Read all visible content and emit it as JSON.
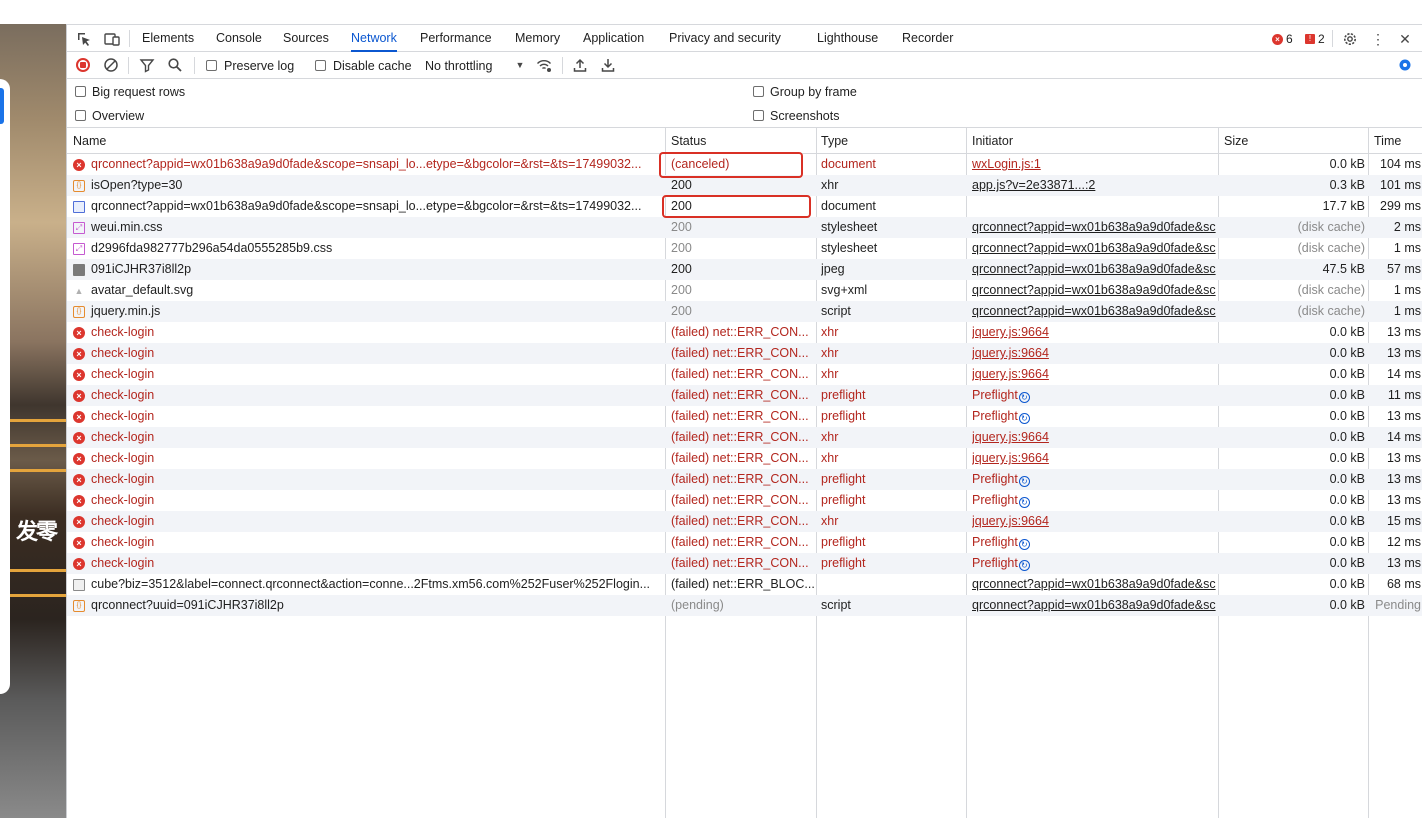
{
  "page": {
    "cjk_text": "发零"
  },
  "tabs": [
    {
      "label": "Elements"
    },
    {
      "label": "Console"
    },
    {
      "label": "Sources"
    },
    {
      "label": "Network",
      "active": true
    },
    {
      "label": "Performance"
    },
    {
      "label": "Memory"
    },
    {
      "label": "Application"
    },
    {
      "label": "Privacy and security"
    },
    {
      "label": "Lighthouse"
    },
    {
      "label": "Recorder"
    }
  ],
  "counts": {
    "errors": "6",
    "issues": "2"
  },
  "toolbar": {
    "preserve_log": "Preserve log",
    "disable_cache": "Disable cache",
    "throttling": "No throttling"
  },
  "settings": {
    "big_rows": "Big request rows",
    "overview": "Overview",
    "group_by_frame": "Group by frame",
    "screenshots": "Screenshots"
  },
  "columns": {
    "name": "Name",
    "status": "Status",
    "type": "Type",
    "initiator": "Initiator",
    "size": "Size",
    "time": "Time"
  },
  "colors": {
    "accent": "#0b57d0",
    "error": "#b3261e",
    "highlight": "#d93025"
  },
  "rows": [
    {
      "icon": "error",
      "name": "qrconnect?appid=wx01b638a9a9d0fade&scope=snsapi_lo...etype=&bgcolor=&rst=&ts=17499032...",
      "status": "(canceled)",
      "type": "document",
      "initiator": "wxLogin.js:1",
      "size": "0.0 kB",
      "time": "104 ms",
      "error": true
    },
    {
      "icon": "xhr",
      "name": "isOpen?type=30",
      "status": "200",
      "type": "xhr",
      "initiator": "app.js?v=2e33871...:2",
      "size": "0.3 kB",
      "time": "101 ms"
    },
    {
      "icon": "doc",
      "name": "qrconnect?appid=wx01b638a9a9d0fade&scope=snsapi_lo...etype=&bgcolor=&rst=&ts=17499032...",
      "status": "200",
      "type": "document",
      "initiator": "",
      "size": "17.7 kB",
      "time": "299 ms"
    },
    {
      "icon": "css",
      "name": "weui.min.css",
      "status": "200",
      "type": "stylesheet",
      "initiator": "qrconnect?appid=wx01b638a9a9d0fade&sc",
      "size": "(disk cache)",
      "time": "2 ms",
      "dim": true
    },
    {
      "icon": "css",
      "name": "d2996fda982777b296a54da0555285b9.css",
      "status": "200",
      "type": "stylesheet",
      "initiator": "qrconnect?appid=wx01b638a9a9d0fade&sc",
      "size": "(disk cache)",
      "time": "1 ms",
      "dim": true
    },
    {
      "icon": "img",
      "name": "091iCJHR37i8ll2p",
      "status": "200",
      "type": "jpeg",
      "initiator": "qrconnect?appid=wx01b638a9a9d0fade&sc",
      "size": "47.5 kB",
      "time": "57 ms"
    },
    {
      "icon": "svg",
      "name": "avatar_default.svg",
      "status": "200",
      "type": "svg+xml",
      "initiator": "qrconnect?appid=wx01b638a9a9d0fade&sc",
      "size": "(disk cache)",
      "time": "1 ms",
      "dim": true
    },
    {
      "icon": "js",
      "name": "jquery.min.js",
      "status": "200",
      "type": "script",
      "initiator": "qrconnect?appid=wx01b638a9a9d0fade&sc",
      "size": "(disk cache)",
      "time": "1 ms",
      "dim": true
    },
    {
      "icon": "error",
      "name": "check-login",
      "status": "(failed) net::ERR_CON...",
      "type": "xhr",
      "initiator": "jquery.js:9664",
      "size": "0.0 kB",
      "time": "13 ms",
      "error": true
    },
    {
      "icon": "error",
      "name": "check-login",
      "status": "(failed) net::ERR_CON...",
      "type": "xhr",
      "initiator": "jquery.js:9664",
      "size": "0.0 kB",
      "time": "13 ms",
      "error": true
    },
    {
      "icon": "error",
      "name": "check-login",
      "status": "(failed) net::ERR_CON...",
      "type": "xhr",
      "initiator": "jquery.js:9664",
      "size": "0.0 kB",
      "time": "14 ms",
      "error": true
    },
    {
      "icon": "error",
      "name": "check-login",
      "status": "(failed) net::ERR_CON...",
      "type": "preflight",
      "initiator": "Preflight",
      "size": "0.0 kB",
      "time": "11 ms",
      "error": true,
      "preflight": true
    },
    {
      "icon": "error",
      "name": "check-login",
      "status": "(failed) net::ERR_CON...",
      "type": "preflight",
      "initiator": "Preflight",
      "size": "0.0 kB",
      "time": "13 ms",
      "error": true,
      "preflight": true
    },
    {
      "icon": "error",
      "name": "check-login",
      "status": "(failed) net::ERR_CON...",
      "type": "xhr",
      "initiator": "jquery.js:9664",
      "size": "0.0 kB",
      "time": "14 ms",
      "error": true
    },
    {
      "icon": "error",
      "name": "check-login",
      "status": "(failed) net::ERR_CON...",
      "type": "xhr",
      "initiator": "jquery.js:9664",
      "size": "0.0 kB",
      "time": "13 ms",
      "error": true
    },
    {
      "icon": "error",
      "name": "check-login",
      "status": "(failed) net::ERR_CON...",
      "type": "preflight",
      "initiator": "Preflight",
      "size": "0.0 kB",
      "time": "13 ms",
      "error": true,
      "preflight": true
    },
    {
      "icon": "error",
      "name": "check-login",
      "status": "(failed) net::ERR_CON...",
      "type": "preflight",
      "initiator": "Preflight",
      "size": "0.0 kB",
      "time": "13 ms",
      "error": true,
      "preflight": true
    },
    {
      "icon": "error",
      "name": "check-login",
      "status": "(failed) net::ERR_CON...",
      "type": "xhr",
      "initiator": "jquery.js:9664",
      "size": "0.0 kB",
      "time": "15 ms",
      "error": true
    },
    {
      "icon": "error",
      "name": "check-login",
      "status": "(failed) net::ERR_CON...",
      "type": "preflight",
      "initiator": "Preflight",
      "size": "0.0 kB",
      "time": "12 ms",
      "error": true,
      "preflight": true
    },
    {
      "icon": "error",
      "name": "check-login",
      "status": "(failed) net::ERR_CON...",
      "type": "preflight",
      "initiator": "Preflight",
      "size": "0.0 kB",
      "time": "13 ms",
      "error": true,
      "preflight": true
    },
    {
      "icon": "other",
      "name": "cube?biz=3512&label=connect.qrconnect&action=conne...2Ftms.xm56.com%252Fuser%252Flogin...",
      "status": "(failed) net::ERR_BLOC...",
      "type": "",
      "initiator": "qrconnect?appid=wx01b638a9a9d0fade&sc",
      "size": "0.0 kB",
      "time": "68 ms",
      "blocked": true
    },
    {
      "icon": "js",
      "name": "qrconnect?uuid=091iCJHR37i8ll2p",
      "status": "(pending)",
      "type": "script",
      "initiator": "qrconnect?appid=wx01b638a9a9d0fade&sc",
      "size": "0.0 kB",
      "time": "Pending",
      "pending": true
    }
  ]
}
